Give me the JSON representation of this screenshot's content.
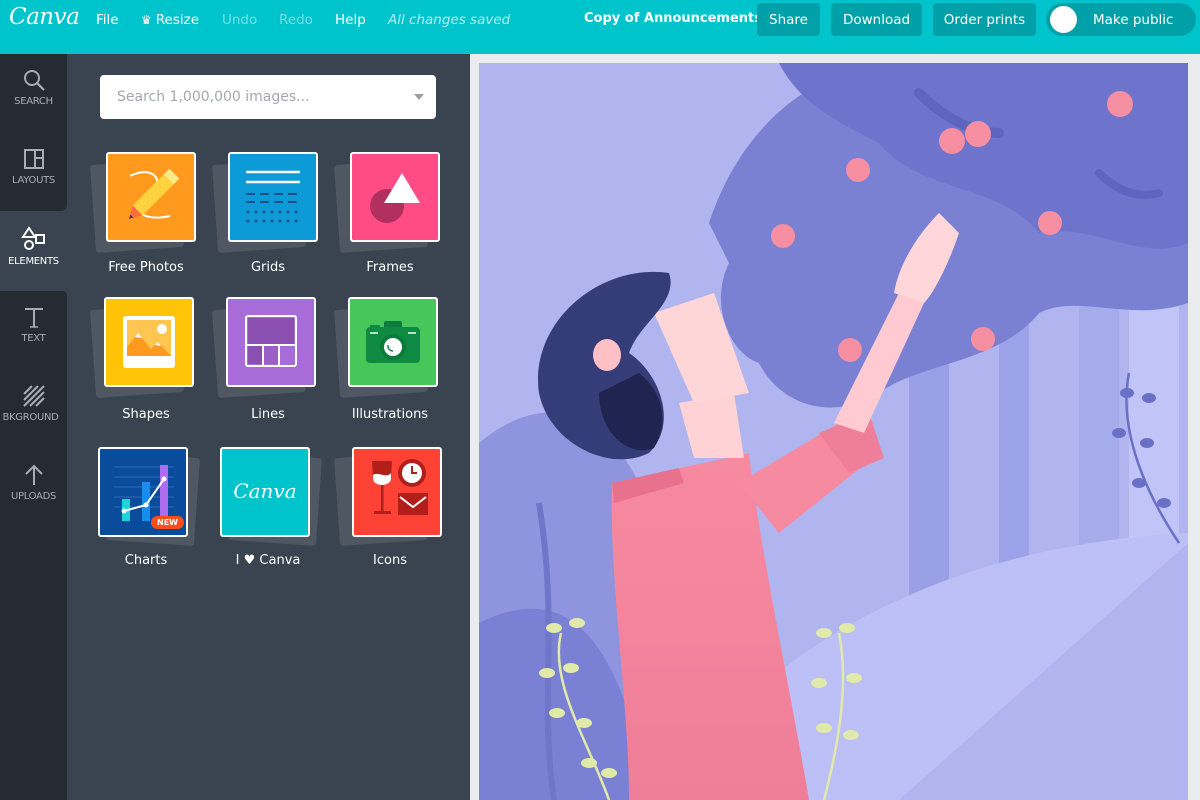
{
  "header": {
    "logo": "Canva",
    "menu": {
      "file": "File",
      "resize": "Resize",
      "undo": "Undo",
      "redo": "Redo",
      "help": "Help"
    },
    "save_status": "All changes saved",
    "document_title": "Copy of Announcements",
    "share_label": "Share",
    "download_label": "Download",
    "order_prints_label": "Order prints",
    "make_public_label": "Make public",
    "make_public_on": false,
    "brand_color": "#00c4cc",
    "button_color": "#00a0a8"
  },
  "rail": {
    "items": [
      {
        "label": "SEARCH",
        "icon": "search-icon",
        "active": false
      },
      {
        "label": "LAYOUTS",
        "icon": "layouts-icon",
        "active": false
      },
      {
        "label": "ELEMENTS",
        "icon": "elements-icon",
        "active": true
      },
      {
        "label": "TEXT",
        "icon": "text-icon",
        "active": false
      },
      {
        "label": "BKGROUND",
        "icon": "background-icon",
        "active": false
      },
      {
        "label": "UPLOADS",
        "icon": "upload-icon",
        "active": false
      }
    ]
  },
  "panel": {
    "search_placeholder": "Search 1,000,000 images...",
    "search_value": "",
    "categories": [
      {
        "label": "Free Photos",
        "color": "#ff9a1f",
        "icon": "pencil-icon"
      },
      {
        "label": "Grids",
        "color": "#0c9bd6",
        "icon": "grid-lines-icon"
      },
      {
        "label": "Frames",
        "color": "#ff4c86",
        "icon": "frame-shapes-icon"
      },
      {
        "label": "Shapes",
        "color": "#ffc408",
        "icon": "picture-icon"
      },
      {
        "label": "Lines",
        "color": "#a86cd8",
        "icon": "layout-grid-icon"
      },
      {
        "label": "Illustrations",
        "color": "#47c75a",
        "icon": "camera-icon"
      },
      {
        "label": "Charts",
        "color": "#0a4c9c",
        "icon": "chart-icon",
        "badge": "NEW"
      },
      {
        "label_prefix": "I",
        "label_suffix": "Canva",
        "color": "#00c4cc",
        "icon": "canva-logo-icon",
        "script_text": "Canva"
      },
      {
        "label": "Icons",
        "color": "#ff4236",
        "icon": "wine-clock-mail-icon"
      }
    ]
  },
  "canvas": {
    "description": "Illustration of a person reaching for fruit in a purple forest"
  }
}
